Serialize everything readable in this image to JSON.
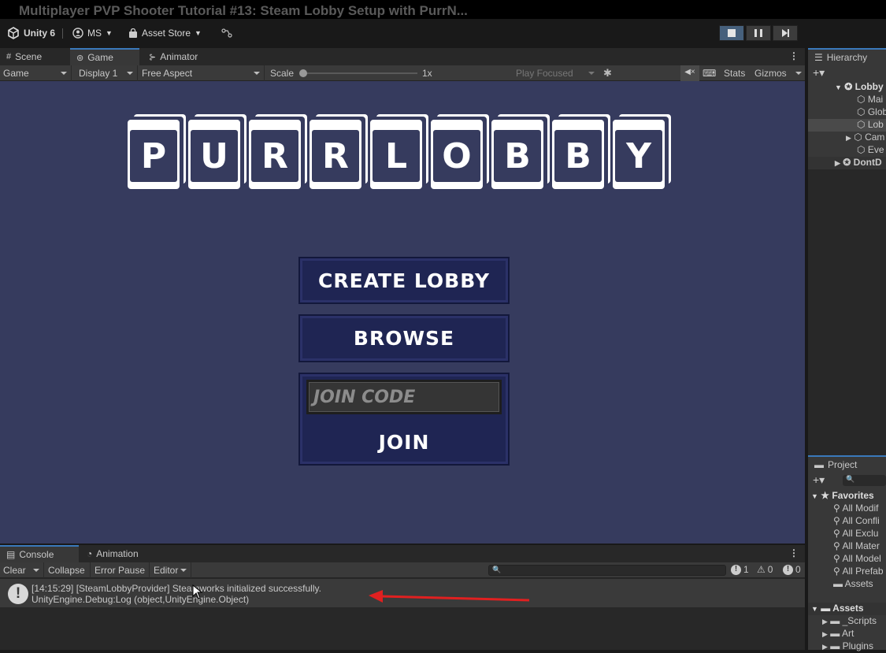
{
  "video_title": "Multiplayer PVP Shooter Tutorial #13: Steam Lobby Setup with PurrN...",
  "toolbar": {
    "app_label": "Unity 6",
    "account_label": "MS",
    "asset_store_label": "Asset Store"
  },
  "game_panel": {
    "tabs": [
      {
        "label": "Scene",
        "icon": "grid-icon"
      },
      {
        "label": "Game",
        "icon": "gamepad-icon"
      },
      {
        "label": "Animator",
        "icon": "animator-icon"
      }
    ],
    "controls": {
      "view_select": "Game",
      "display_select": "Display 1",
      "aspect_select": "Free Aspect",
      "scale_label": "Scale",
      "scale_value": "1x",
      "play_focused": "Play Focused",
      "stats": "Stats",
      "gizmos": "Gizmos"
    }
  },
  "game_ui": {
    "logo_letters": [
      "P",
      "U",
      "R",
      "R",
      "L",
      "O",
      "B",
      "B",
      "Y"
    ],
    "create_lobby_label": "CREATE LOBBY",
    "browse_label": "BROWSE",
    "join_code_placeholder": "JOIN CODE",
    "join_label": "JOIN"
  },
  "hierarchy": {
    "tab_label": "Hierarchy",
    "items": [
      "Lobby",
      "Mai",
      "Glob",
      "Lob",
      "Cam",
      "Eve",
      "DontD"
    ]
  },
  "project": {
    "tab_label": "Project",
    "favorites_label": "Favorites",
    "favorites": [
      "All Modif",
      "All Confli",
      "All Exclu",
      "All Mater",
      "All Model",
      "All Prefab"
    ],
    "favorites_assets": "Assets",
    "assets_label": "Assets",
    "folders": [
      "_Scripts",
      "Art",
      "Plugins"
    ]
  },
  "console": {
    "tabs": [
      {
        "label": "Console"
      },
      {
        "label": "Animation"
      }
    ],
    "clear": "Clear",
    "collapse": "Collapse",
    "error_pause": "Error Pause",
    "editor": "Editor",
    "log_count": "1",
    "warn_count": "0",
    "error_count": "0",
    "log_line1": "[14:15:29] [SteamLobbyProvider] Steamworks initialized successfully.",
    "log_line2": "UnityEngine.Debug:Log (object,UnityEngine.Object)"
  },
  "colors": {
    "game_bg": "#363b5e",
    "button_fill": "#1f2553",
    "annotation_arrow": "#e02020",
    "play_active": "#46607c"
  }
}
